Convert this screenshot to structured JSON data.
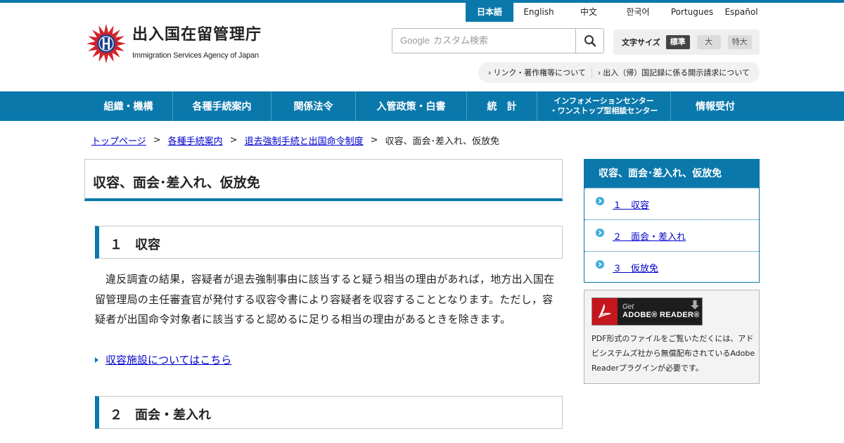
{
  "languages": [
    {
      "label": "日本語",
      "active": true
    },
    {
      "label": "English",
      "active": false
    },
    {
      "label": "中文",
      "active": false
    },
    {
      "label": "한국어",
      "active": false
    },
    {
      "label": "Portugues",
      "active": false
    },
    {
      "label": "Español",
      "active": false
    }
  ],
  "logo": {
    "name_ja": "出入国在留管理庁",
    "name_en": "Immigration Services Agency of Japan"
  },
  "search": {
    "placeholder": "カスタム検索",
    "brand": "Google"
  },
  "font_size": {
    "label": "文字サイズ",
    "options": [
      "標準",
      "大",
      "特大"
    ]
  },
  "utility_links": [
    "リンク・著作権等について",
    "出入（帰）国記録に係る開示請求について"
  ],
  "global_nav": [
    {
      "label": "組織・機構"
    },
    {
      "label": "各種手続案内"
    },
    {
      "label": "関係法令"
    },
    {
      "label": "入管政策・白書"
    },
    {
      "label": "統　計"
    },
    {
      "label_line1": "インフォメーションセンター",
      "label_line2": "・ワンストップ型相談センター"
    },
    {
      "label": "情報受付"
    }
  ],
  "breadcrumb": [
    "トップページ",
    "各種手続案内",
    "退去強制手続と出国命令制度",
    "収容、面会･差入れ、仮放免"
  ],
  "page_title": "収容、面会･差入れ、仮放免",
  "sections": [
    {
      "heading": "１　収容"
    },
    {
      "heading": "２　面会・差入れ"
    }
  ],
  "body_text": "違反調査の結果，容疑者が退去強制事由に該当すると疑う相当の理由があれば，地方出入国在留管理局の主任審査官が発付する収容令書により容疑者を収容することとなります。ただし，容疑者が出国命令対象者に該当すると認めるに足りる相当の理由があるときを除きます。",
  "inline_link": "収容施設についてはこちら",
  "side_nav": {
    "title": "収容、面会･差入れ、仮放免",
    "items": [
      "１　収容",
      "２　面会・差入れ",
      "３　仮放免"
    ]
  },
  "adobe": {
    "get": "Get",
    "reader": "ADOBE® READER®",
    "text": "PDF形式のファイルをご覧いただくには、アドビシステムズ社から無償配布されているAdobe Readerプラグインが必要です。"
  },
  "colors": {
    "brand_blue": "#0a78ab",
    "link": "#0000cc"
  }
}
